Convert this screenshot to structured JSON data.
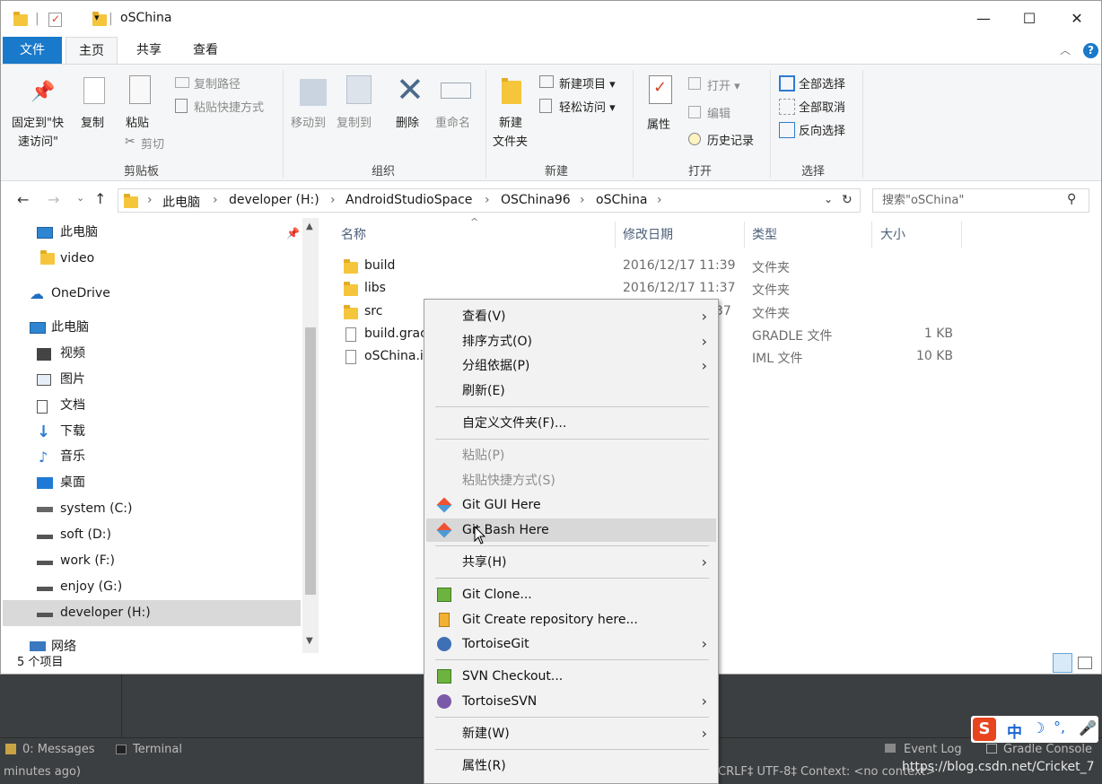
{
  "window": {
    "title": "oSChina",
    "minimize": "—",
    "maximize": "☐",
    "close": "✕"
  },
  "tabs": {
    "file": "文件",
    "home": "主页",
    "share": "共享",
    "view": "查看"
  },
  "ribbon": {
    "pin_label_1": "固定到\"快",
    "pin_label_2": "速访问\"",
    "copy": "复制",
    "paste": "粘贴",
    "copy_path": "复制路径",
    "paste_shortcut": "粘贴快捷方式",
    "cut": "剪切",
    "group_clipboard": "剪贴板",
    "move_to": "移动到",
    "copy_to": "复制到",
    "delete": "删除",
    "rename": "重命名",
    "group_organize": "组织",
    "new_folder_1": "新建",
    "new_folder_2": "文件夹",
    "new_item": "新建项目 ▾",
    "easy_access": "轻松访问 ▾",
    "group_new": "新建",
    "properties": "属性",
    "open": "打开 ▾",
    "edit": "编辑",
    "history": "历史记录",
    "group_open": "打开",
    "select_all": "全部选择",
    "select_none": "全部取消",
    "invert_selection": "反向选择",
    "group_select": "选择"
  },
  "address": {
    "crumbs": [
      "此电脑",
      "developer (H:)",
      "AndroidStudioSpace",
      "OSChina96",
      "oSChina"
    ],
    "search_placeholder": "搜索\"oSChina\""
  },
  "nav": {
    "items": [
      {
        "label": "此电脑",
        "icon": "pc-icon"
      },
      {
        "label": "video",
        "icon": "folder-icon"
      },
      {
        "label": "OneDrive",
        "icon": "cloud-icon"
      },
      {
        "label": "此电脑",
        "icon": "pc-icon"
      },
      {
        "label": "视频",
        "icon": "video-icon"
      },
      {
        "label": "图片",
        "icon": "picture-icon"
      },
      {
        "label": "文档",
        "icon": "document-icon"
      },
      {
        "label": "下载",
        "icon": "download-icon"
      },
      {
        "label": "音乐",
        "icon": "music-icon"
      },
      {
        "label": "桌面",
        "icon": "desktop-icon"
      },
      {
        "label": "system (C:)",
        "icon": "drive-icon"
      },
      {
        "label": "soft (D:)",
        "icon": "drive-icon"
      },
      {
        "label": "work (F:)",
        "icon": "drive-icon"
      },
      {
        "label": "enjoy (G:)",
        "icon": "drive-icon"
      },
      {
        "label": "developer (H:)",
        "icon": "drive-icon"
      },
      {
        "label": "网络",
        "icon": "network-icon"
      }
    ]
  },
  "list": {
    "headers": {
      "name": "名称",
      "date": "修改日期",
      "type": "类型",
      "size": "大小"
    },
    "rows": [
      {
        "name": "build",
        "date": "2016/12/17 11:39",
        "type": "文件夹",
        "size": ""
      },
      {
        "name": "libs",
        "date": "2016/12/17 11:37",
        "type": "文件夹",
        "size": ""
      },
      {
        "name": "src",
        "date": "37",
        "type": "文件夹",
        "size": ""
      },
      {
        "name": "build.grac",
        "date": "",
        "type": "GRADLE 文件",
        "size": "1 KB"
      },
      {
        "name": "oSChina.ir",
        "date": "",
        "type": "IML 文件",
        "size": "10 KB"
      }
    ]
  },
  "status": {
    "count": "5 个项目"
  },
  "menu": {
    "view": "查看(V)",
    "sort": "排序方式(O)",
    "group": "分组依据(P)",
    "refresh": "刷新(E)",
    "customize": "自定义文件夹(F)...",
    "paste": "粘贴(P)",
    "paste_shortcut": "粘贴快捷方式(S)",
    "git_gui": "Git GUI Here",
    "git_bash": "Git Bash Here",
    "share": "共享(H)",
    "git_clone": "Git Clone...",
    "git_create": "Git Create repository here...",
    "tortoisegit": "TortoiseGit",
    "svn_checkout": "SVN Checkout...",
    "tortoisesvn": "TortoiseSVN",
    "new": "新建(W)",
    "properties": "属性(R)"
  },
  "ide": {
    "messages": "0: Messages",
    "terminal": "Terminal",
    "minutes_ago": "minutes ago)",
    "event_log": "Event Log",
    "gradle_console": "Gradle Console",
    "encoding": "CRLF‡  UTF-8‡  Context: <no context>",
    "watermark": "https://blog.csdn.net/Cricket_7"
  },
  "sogou": {
    "lang": "中"
  }
}
